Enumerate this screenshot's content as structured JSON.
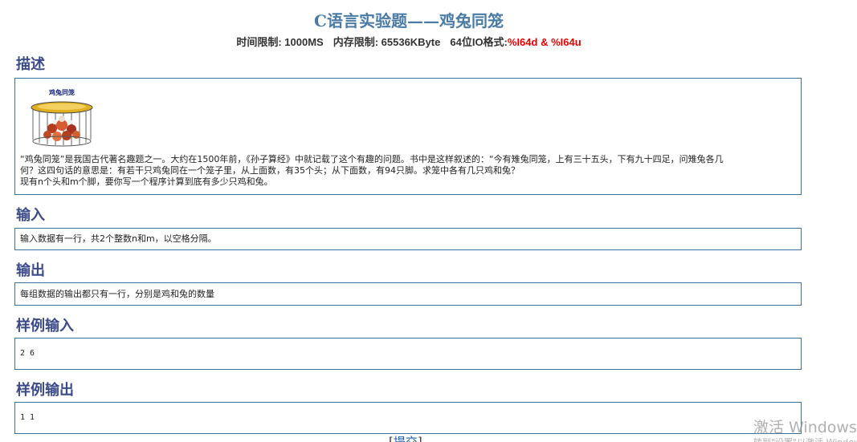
{
  "header": {
    "title": "C语言实验题——鸡兔同笼",
    "time_limit": "时间限制: 1000MS",
    "memory_limit": "内存限制: 65536KByte",
    "io_format_label": "64位IO格式:",
    "io_format_value": "%I64d & %I64u"
  },
  "description": {
    "heading": "描述",
    "image_caption": "鸡兔同笼",
    "line1": "“鸡兔同笼”是我国古代著名趣题之一。大约在1500年前，《孙子算经》中就记载了这个有趣的问题。书中是这样叙述的：“今有雉兔同笼，上有三十五头，下有九十四足，问雉兔各几",
    "line2": "何？这四句话的意思是：有若干只鸡兔同在一个笼子里，从上面数，有35个头；从下面数，有94只脚。求笼中各有几只鸡和兔？",
    "line3": "现有n个头和m个脚，要你写一个程序计算到底有多少只鸡和兔。"
  },
  "input": {
    "heading": "输入",
    "text": "输入数据有一行，共2个整数n和m，以空格分隔。"
  },
  "output": {
    "heading": "输出",
    "text": "每组数据的输出都只有一行，分别是鸡和兔的数量"
  },
  "sample_input": {
    "heading": "样例输入",
    "text": "2 6"
  },
  "sample_output": {
    "heading": "样例输出",
    "text": "1 1"
  },
  "actions": {
    "submit_label": "提交"
  },
  "watermark": {
    "line1": "激活 Windows",
    "line2": "转到\"设置\"以激活 Windows。"
  }
}
